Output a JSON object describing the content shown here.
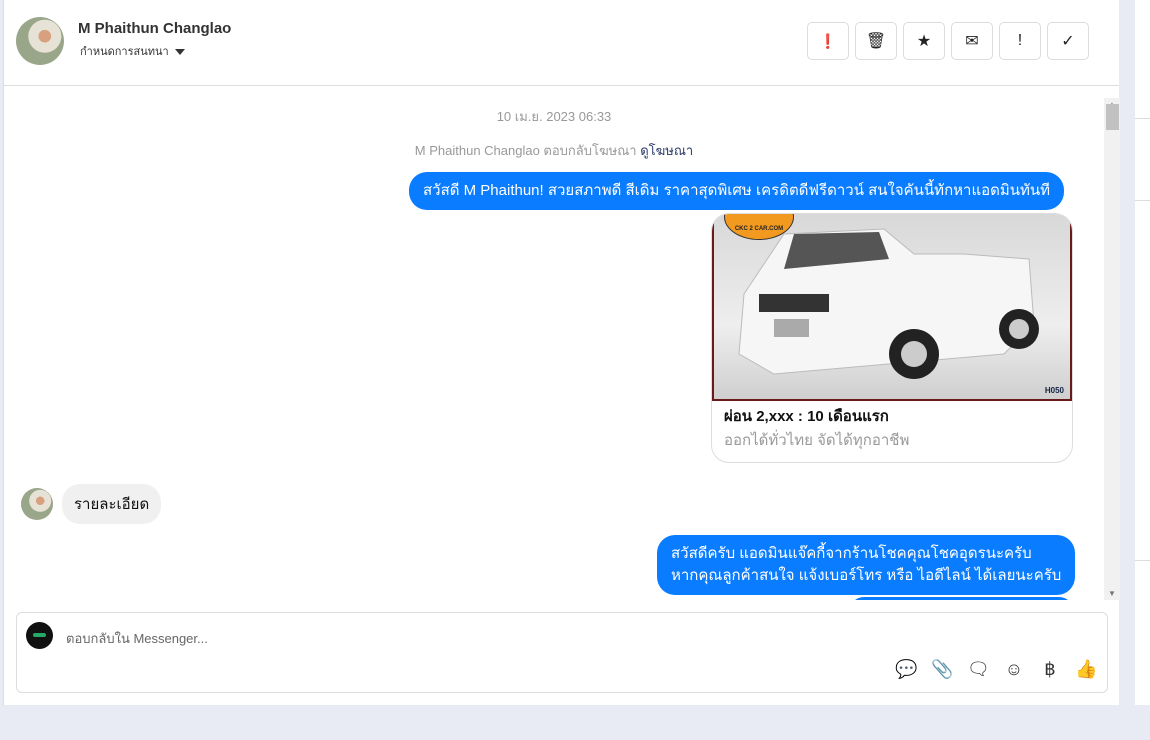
{
  "header": {
    "name": "M Phaithun Changlao",
    "assign_label": "กำหนดการสนทนา",
    "actions": [
      {
        "icon": "alert-circle-icon",
        "glyph": "❗"
      },
      {
        "icon": "trash-icon",
        "glyph": "🗑"
      },
      {
        "icon": "star-icon",
        "glyph": "★"
      },
      {
        "icon": "envelope-icon",
        "glyph": "✉"
      },
      {
        "icon": "exclamation-icon",
        "glyph": "!"
      },
      {
        "icon": "check-icon",
        "glyph": "✓"
      }
    ]
  },
  "chat": {
    "timestamp": "10 เม.ย. 2023 06:33",
    "reply_note": "M Phaithun Changlao ตอบกลับโฆษณา",
    "view_ad_link": "ดูโฆษณา",
    "msg1": "สวัสดี M Phaithun! สวยสภาพดี สีเดิม ราคาสุดพิเศษ เครดิตดีฟรีดาวน์  สนใจคันนี้ทักหาแอดมินทันที",
    "card": {
      "logo": "CKC 2 CAR.COM",
      "code": "H050",
      "title": "ผ่อน 2,xxx : 10 เดือนแรก",
      "subtitle": "ออกได้ทั่วไทย จัดได้ทุกอาชีพ"
    },
    "incoming": "รายละเอียด",
    "msg2_line1": "สวัสดีครับ แอดมินแจ๊คกี้จากร้านโชคคุณโชคอุดรนะครับ",
    "msg2_line2": "หากคุณลูกค้าสนใจ แจ้งเบอร์โทร หรือ ไอดีไลน์ ได้เลยนะครับ"
  },
  "composer": {
    "placeholder": "ตอบกลับใน Messenger..."
  },
  "colors": {
    "accent": "#0a7cff"
  }
}
